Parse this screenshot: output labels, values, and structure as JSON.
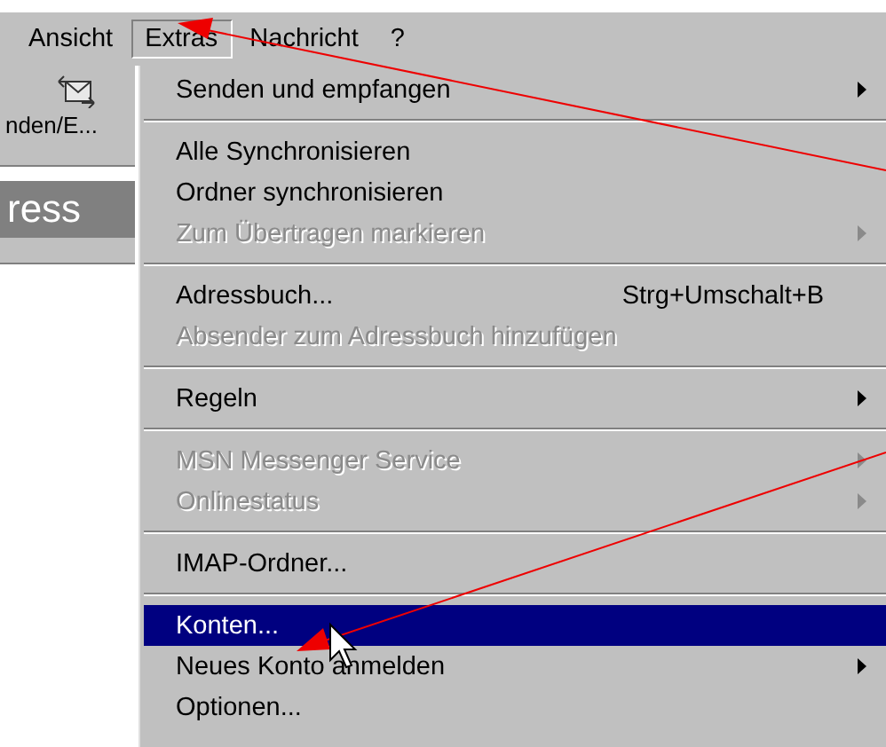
{
  "menubar": [
    {
      "label": "Ansicht",
      "selected": false
    },
    {
      "label": "Extras",
      "selected": true
    },
    {
      "label": "Nachricht",
      "selected": false
    },
    {
      "label": "?",
      "selected": false
    }
  ],
  "toolbar": {
    "button_label": "nden/E..."
  },
  "banner": {
    "title": "ress"
  },
  "menu": [
    {
      "kind": "item",
      "label": "Senden und empfangen",
      "submenu": true,
      "disabled": false,
      "selected": false
    },
    {
      "kind": "separator"
    },
    {
      "kind": "item",
      "label": "Alle Synchronisieren",
      "submenu": false,
      "disabled": false,
      "selected": false
    },
    {
      "kind": "item",
      "label": "Ordner synchronisieren",
      "submenu": false,
      "disabled": false,
      "selected": false
    },
    {
      "kind": "item",
      "label": "Zum Übertragen markieren",
      "submenu": true,
      "disabled": true,
      "selected": false
    },
    {
      "kind": "separator"
    },
    {
      "kind": "item",
      "label": "Adressbuch...",
      "shortcut": "Strg+Umschalt+B",
      "submenu": false,
      "disabled": false,
      "selected": false
    },
    {
      "kind": "item",
      "label": "Absender zum Adressbuch hinzufügen",
      "submenu": false,
      "disabled": true,
      "selected": false
    },
    {
      "kind": "separator"
    },
    {
      "kind": "item",
      "label": "Regeln",
      "submenu": true,
      "disabled": false,
      "selected": false
    },
    {
      "kind": "separator"
    },
    {
      "kind": "item",
      "label": "MSN Messenger Service",
      "submenu": true,
      "disabled": true,
      "selected": false
    },
    {
      "kind": "item",
      "label": "Onlinestatus",
      "submenu": true,
      "disabled": true,
      "selected": false
    },
    {
      "kind": "separator"
    },
    {
      "kind": "item",
      "label": "IMAP-Ordner...",
      "submenu": false,
      "disabled": false,
      "selected": false
    },
    {
      "kind": "separator"
    },
    {
      "kind": "item",
      "label": "Konten...",
      "submenu": false,
      "disabled": false,
      "selected": true
    },
    {
      "kind": "item",
      "label": "Neues Konto anmelden",
      "submenu": true,
      "disabled": false,
      "selected": false
    },
    {
      "kind": "item",
      "label": "Optionen...",
      "submenu": false,
      "disabled": false,
      "selected": false
    }
  ]
}
